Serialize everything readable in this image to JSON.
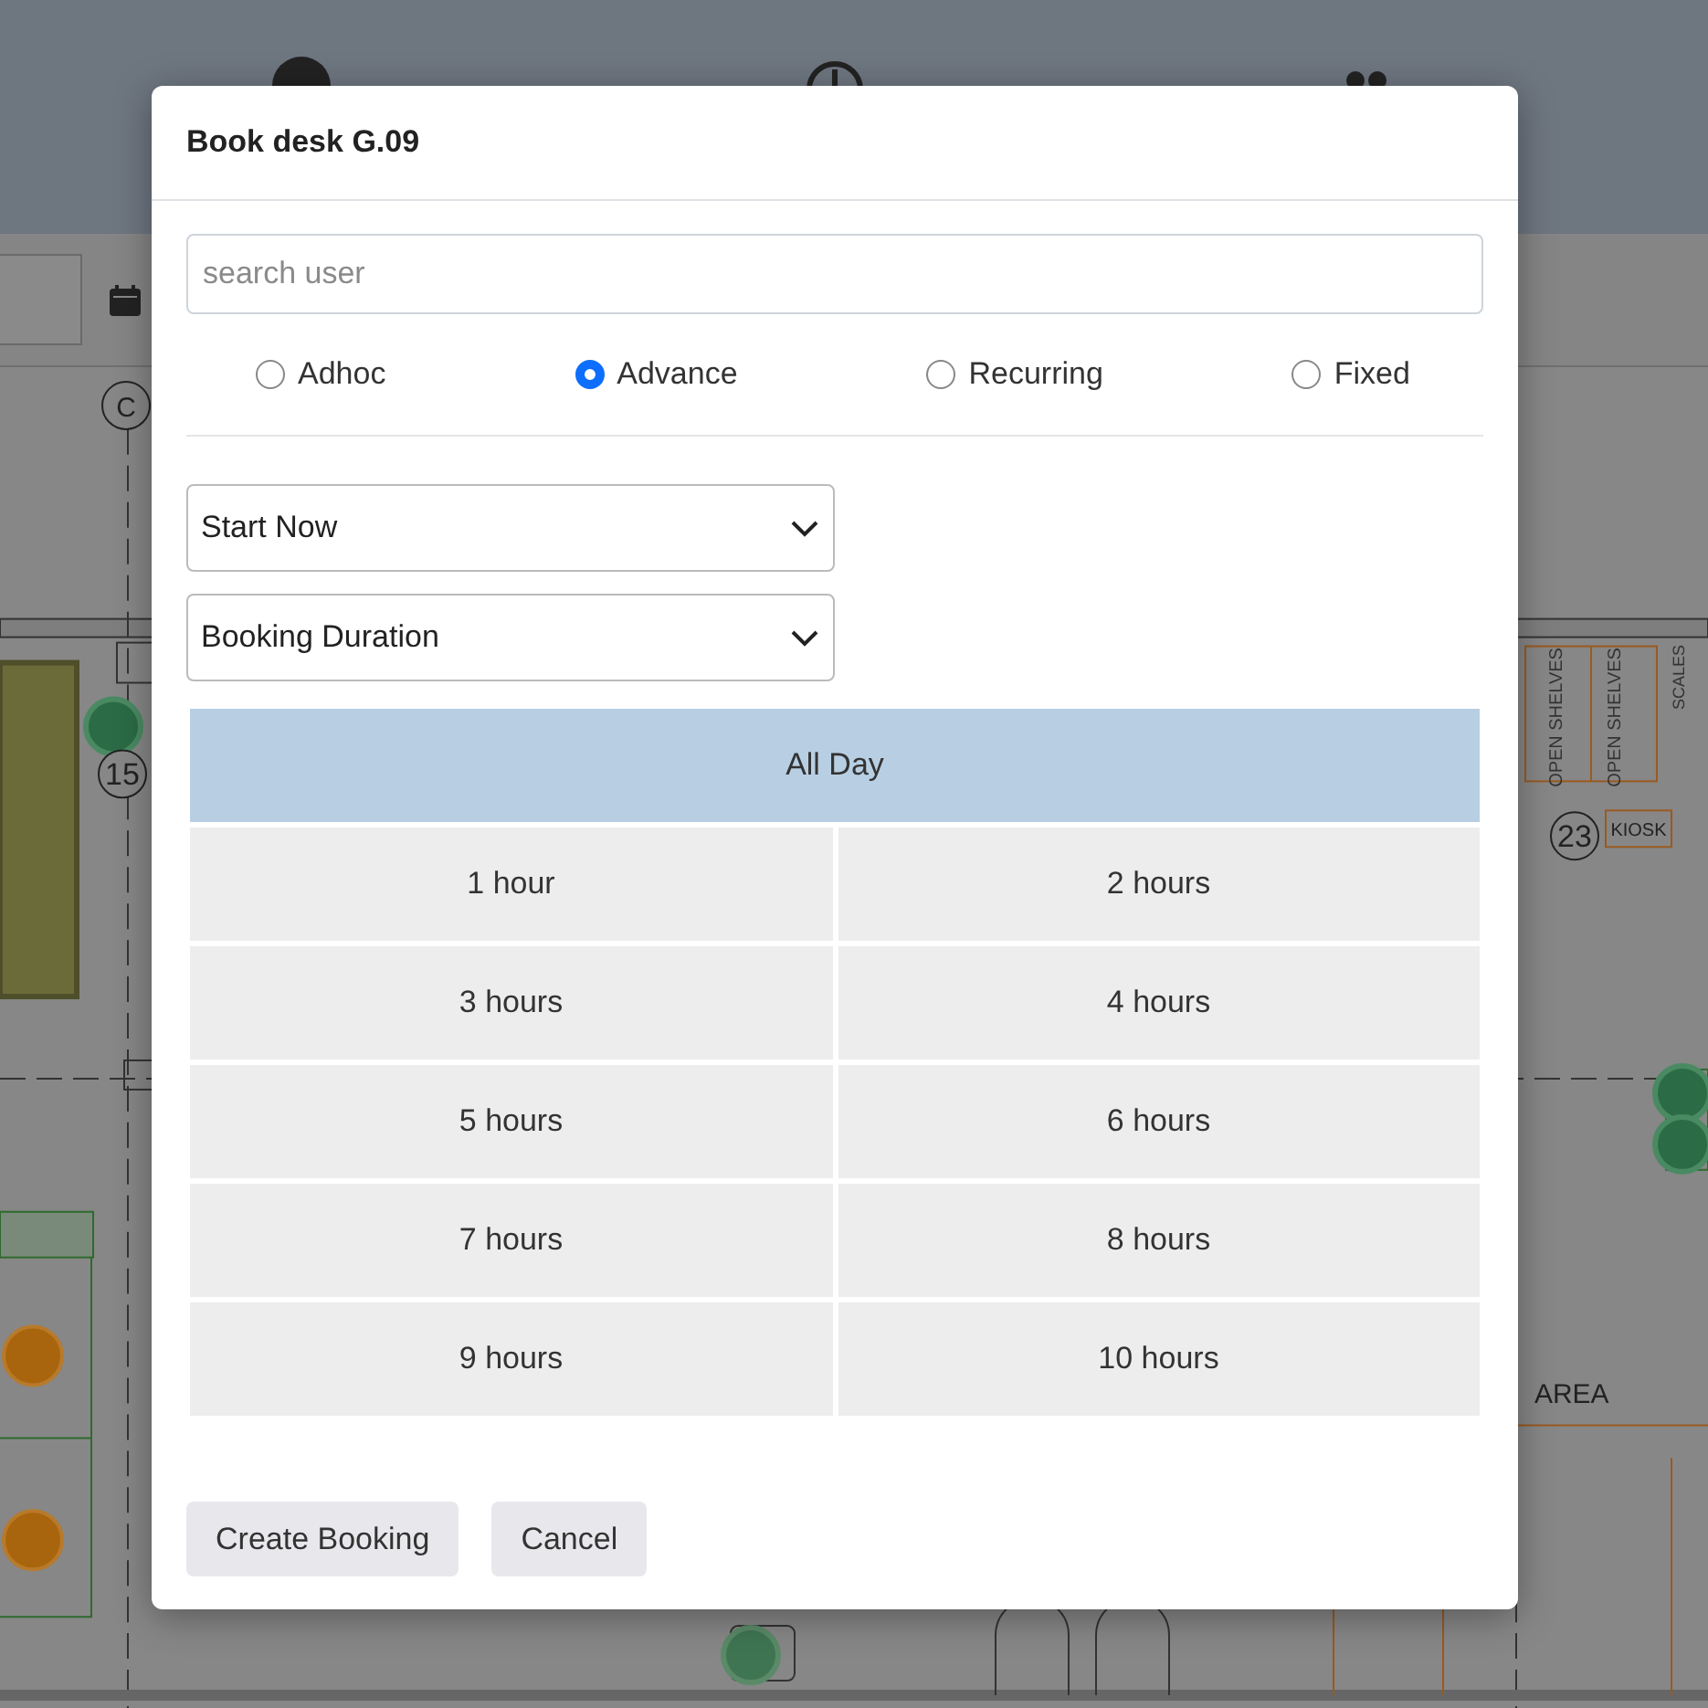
{
  "floor_plan": {
    "labels": [
      {
        "kind": "circle",
        "text": "C"
      },
      {
        "kind": "circle",
        "text": "15"
      },
      {
        "kind": "circle",
        "text": "23"
      },
      {
        "kind": "boxed",
        "text": "KIOSK"
      },
      {
        "kind": "vertical",
        "text": "OPEN SHELVES"
      },
      {
        "kind": "vertical",
        "text": "OPEN SHELVES"
      },
      {
        "kind": "vertical",
        "text": "SCALES"
      },
      {
        "kind": "plain",
        "text": "AREA"
      }
    ]
  },
  "dialog": {
    "title": "Book desk G.09",
    "search": {
      "placeholder": "search user"
    },
    "booking_types": [
      {
        "label": "Adhoc",
        "selected": false
      },
      {
        "label": "Advance",
        "selected": true
      },
      {
        "label": "Recurring",
        "selected": false
      },
      {
        "label": "Fixed",
        "selected": false
      }
    ],
    "selects": [
      {
        "value": "Start Now"
      },
      {
        "value": "Booking Duration"
      }
    ],
    "durations": [
      {
        "label": "All Day",
        "kind": "wide",
        "selected": true
      },
      {
        "label": "1 hour",
        "kind": "normal",
        "selected": false
      },
      {
        "label": "2 hours",
        "kind": "normal",
        "selected": false
      },
      {
        "label": "3 hours",
        "kind": "normal",
        "selected": false
      },
      {
        "label": "4 hours",
        "kind": "normal",
        "selected": false
      },
      {
        "label": "5 hours",
        "kind": "normal",
        "selected": false
      },
      {
        "label": "6 hours",
        "kind": "normal",
        "selected": false
      },
      {
        "label": "7 hours",
        "kind": "normal",
        "selected": false
      },
      {
        "label": "8 hours",
        "kind": "normal",
        "selected": false
      },
      {
        "label": "9 hours",
        "kind": "normal",
        "selected": false
      },
      {
        "label": "10 hours",
        "kind": "normal",
        "selected": false
      }
    ],
    "buttons": [
      "Create Booking",
      "Cancel"
    ]
  }
}
